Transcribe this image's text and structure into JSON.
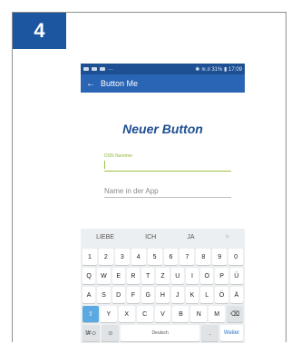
{
  "step_number": "4",
  "status": {
    "right_text": "✱ ≋.ıl 31% ▮ 17:09"
  },
  "appbar": {
    "title": "Button Me",
    "back_glyph": "←"
  },
  "main": {
    "title": "Neuer Button",
    "dsn_label": "DSN Nummer",
    "dsn_value": "",
    "name_placeholder": "Name in der App"
  },
  "keyboard": {
    "suggestions": [
      "LIEBE",
      "ICH",
      "JA"
    ],
    "suggest_arrow": ">",
    "row_numbers": [
      "1",
      "2",
      "3",
      "4",
      "5",
      "6",
      "7",
      "8",
      "9",
      "0"
    ],
    "row1": [
      "Q",
      "W",
      "E",
      "R",
      "T",
      "Z",
      "U",
      "I",
      "O",
      "P",
      "Ü"
    ],
    "row2": [
      "A",
      "S",
      "D",
      "F",
      "G",
      "H",
      "J",
      "K",
      "L",
      "Ö",
      "Ä"
    ],
    "row3": [
      "Y",
      "X",
      "C",
      "V",
      "B",
      "N",
      "M"
    ],
    "shift_glyph": "⇧",
    "backspace_glyph": "⌫",
    "symbols_label": "!#☺",
    "emoji_glyph": "☺",
    "space_label": "Deutsch",
    "period_label": ".",
    "enter_label": "Weiter"
  },
  "colors": {
    "badge": "#1c55a0",
    "appbar": "#2a64b5",
    "accent_green": "#9bc23e",
    "title_blue": "#1f4f92"
  }
}
